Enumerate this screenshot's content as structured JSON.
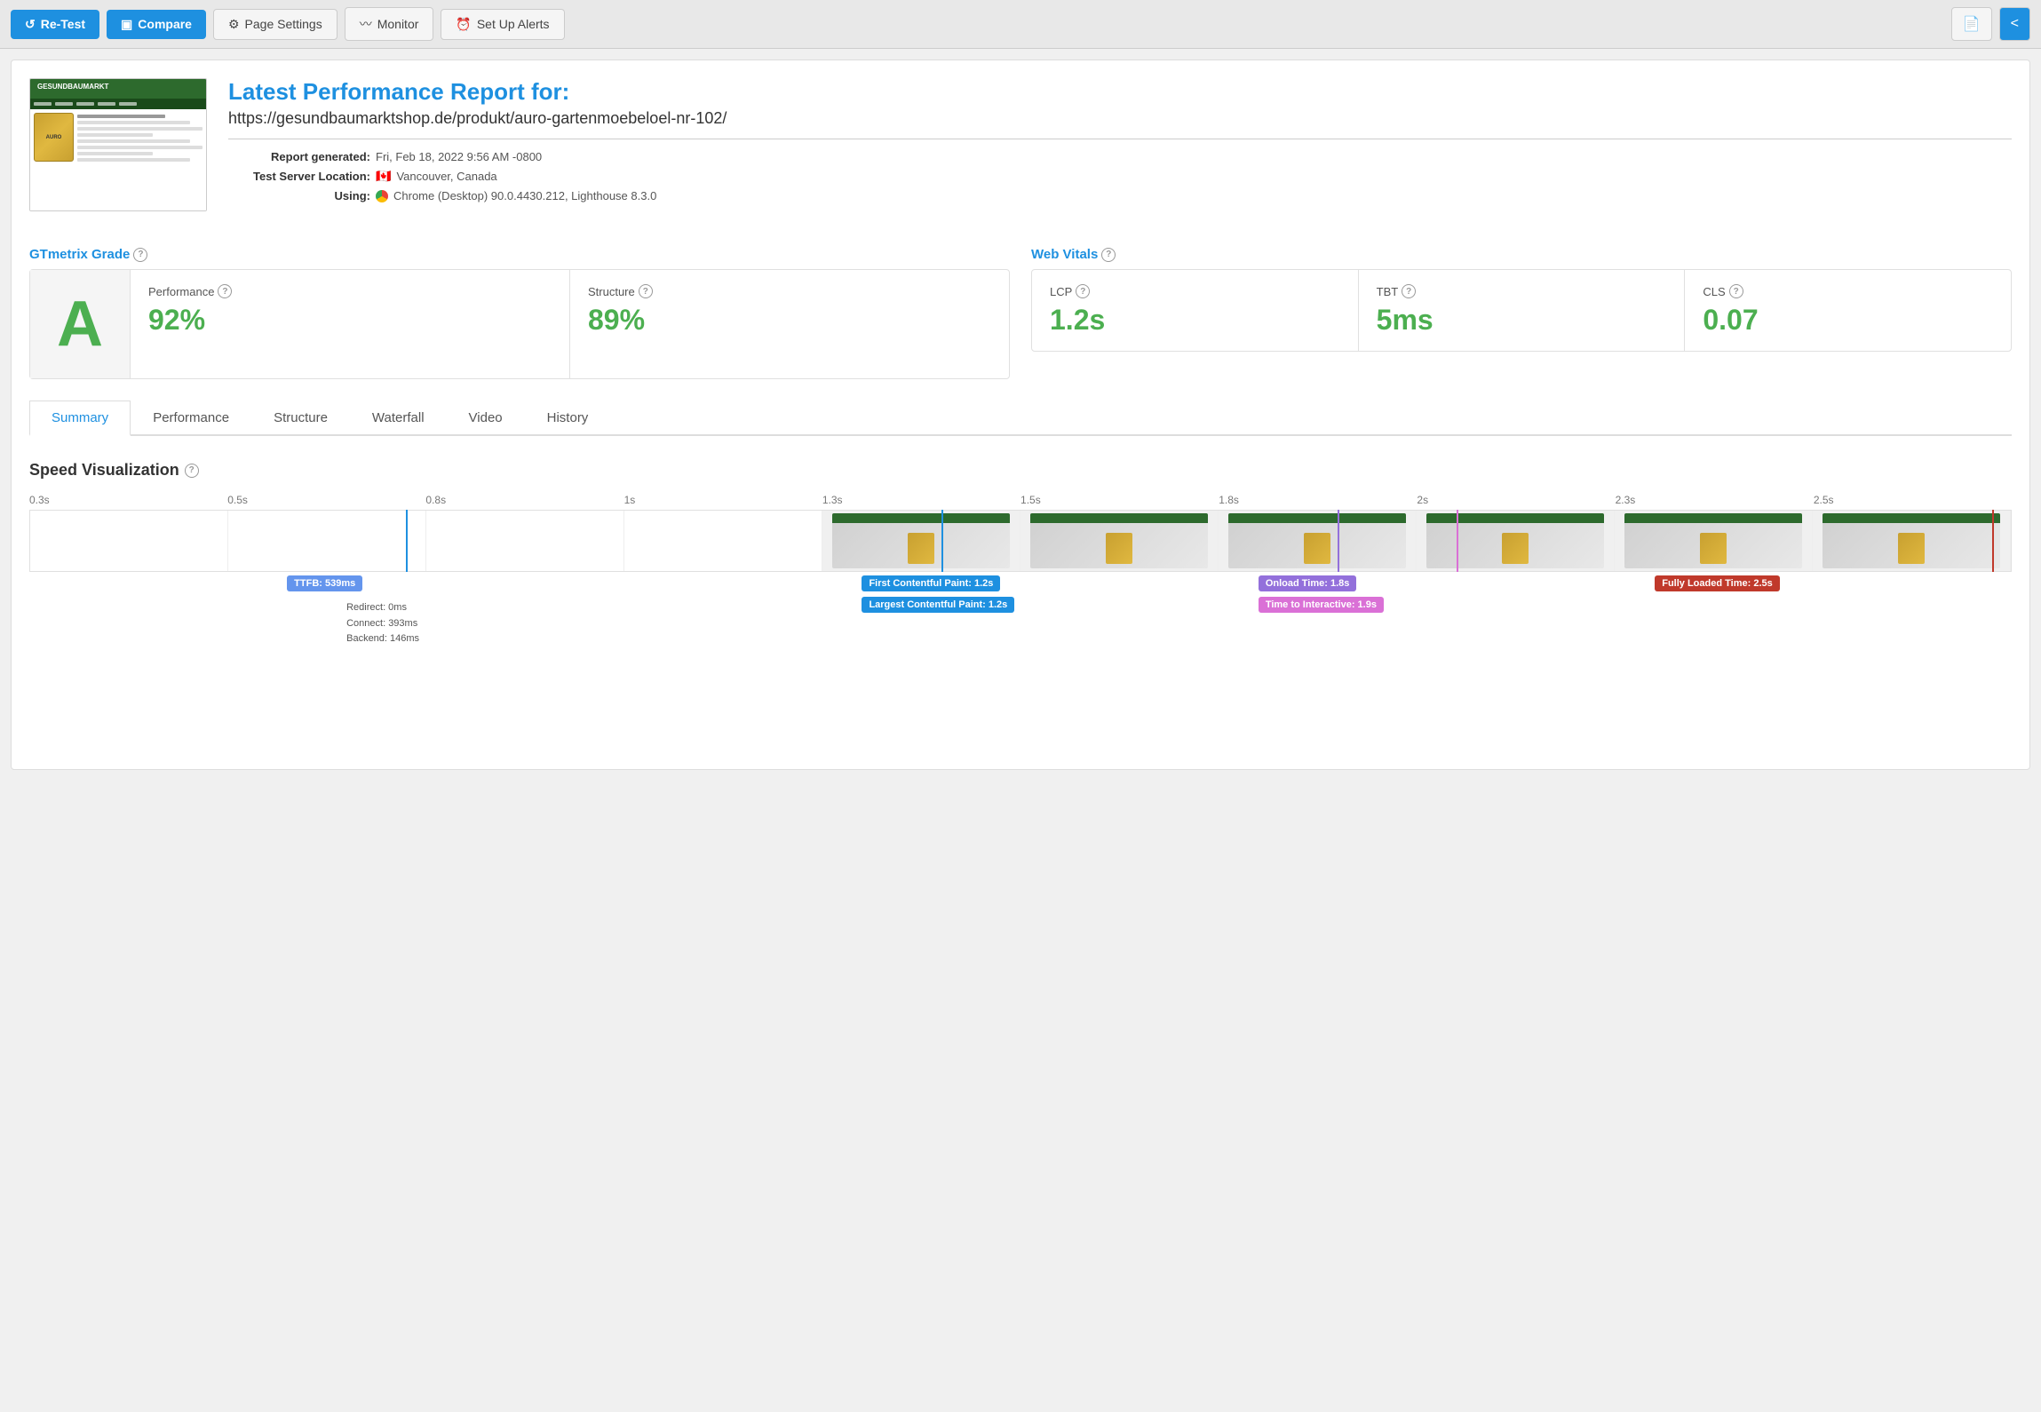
{
  "toolbar": {
    "retest_label": "Re-Test",
    "compare_label": "Compare",
    "page_settings_label": "Page Settings",
    "monitor_label": "Monitor",
    "set_up_alerts_label": "Set Up Alerts",
    "pdf_label": "PDF",
    "share_label": "⋮"
  },
  "report": {
    "title": "Latest Performance Report for:",
    "url": "https://gesundbaumarktshop.de/produkt/auro-gartenmoebeloel-nr-102/",
    "generated_label": "Report generated:",
    "generated_value": "Fri, Feb 18, 2022 9:56 AM -0800",
    "server_label": "Test Server Location:",
    "server_flag": "🇨🇦",
    "server_value": "Vancouver, Canada",
    "using_label": "Using:",
    "using_value": "Chrome (Desktop) 90.0.4430.212, Lighthouse 8.3.0"
  },
  "gtmetrix": {
    "title": "GTmetrix Grade",
    "grade": "A",
    "performance_label": "Performance",
    "performance_value": "92%",
    "structure_label": "Structure",
    "structure_value": "89%"
  },
  "web_vitals": {
    "title": "Web Vitals",
    "lcp_label": "LCP",
    "lcp_value": "1.2s",
    "tbt_label": "TBT",
    "tbt_value": "5ms",
    "cls_label": "CLS",
    "cls_value": "0.07"
  },
  "tabs": [
    {
      "label": "Summary",
      "active": true
    },
    {
      "label": "Performance",
      "active": false
    },
    {
      "label": "Structure",
      "active": false
    },
    {
      "label": "Waterfall",
      "active": false
    },
    {
      "label": "Video",
      "active": false
    },
    {
      "label": "History",
      "active": false
    }
  ],
  "speed_viz": {
    "title": "Speed Visualization",
    "ruler": [
      "0.3s",
      "0.5s",
      "0.8s",
      "1s",
      "1.3s",
      "1.5s",
      "1.8s",
      "2s",
      "2.3s",
      "2.5s"
    ],
    "ttfb_label": "TTFB: 539ms",
    "ttfb_detail": "Redirect: 0ms\nConnect: 393ms\nBackend: 146ms",
    "fcp_label": "First Contentful Paint: 1.2s",
    "lcp_label": "Largest Contentful Paint: 1.2s",
    "onload_label": "Onload Time: 1.8s",
    "tti_label": "Time to Interactive: 1.9s",
    "fully_label": "Fully Loaded Time: 2.5s"
  }
}
